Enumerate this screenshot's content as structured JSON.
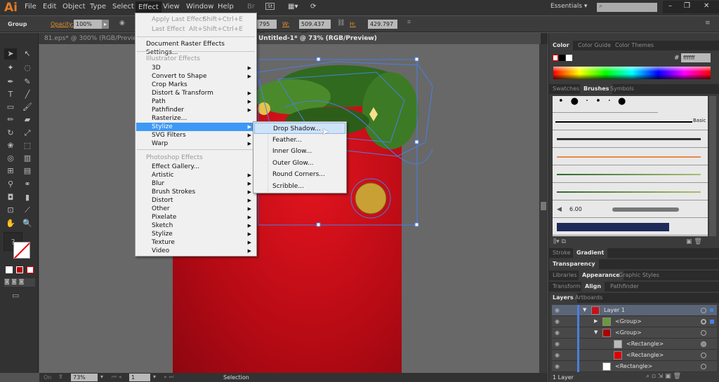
{
  "app": {
    "logo": "Ai"
  },
  "menubar": {
    "items": [
      "File",
      "Edit",
      "Object",
      "Type",
      "Select",
      "Effect",
      "View",
      "Window",
      "Help"
    ],
    "workspace": "Essentials",
    "search_placeholder": ""
  },
  "control": {
    "selection": "Group",
    "opacity_label": "Opacity:",
    "opacity": "100%",
    "x_value": "795 pt",
    "w_label": "W:",
    "w_value": "509.437 pt",
    "h_label": "H:",
    "h_value": "429.797 pt"
  },
  "doc_tabs": [
    {
      "label": "81.eps* @ 300% (RGB/Preview)",
      "active": false
    },
    {
      "label": "Untitled-1* @ 73% (RGB/Preview)",
      "active": true
    }
  ],
  "effect_menu": {
    "apply_last": {
      "label": "Apply Last Effect",
      "shortcut": "Shift+Ctrl+E"
    },
    "last": {
      "label": "Last Effect",
      "shortcut": "Alt+Shift+Ctrl+E"
    },
    "doc_raster": "Document Raster Effects Settings...",
    "illustrator_header": "Illustrator Effects",
    "illustrator_items": [
      "3D",
      "Convert to Shape",
      "Crop Marks",
      "Distort & Transform",
      "Path",
      "Pathfinder",
      "Rasterize...",
      "Stylize",
      "SVG Filters",
      "Warp"
    ],
    "photoshop_header": "Photoshop Effects",
    "photoshop_items": [
      "Effect Gallery...",
      "Artistic",
      "Blur",
      "Brush Strokes",
      "Distort",
      "Other",
      "Pixelate",
      "Sketch",
      "Stylize",
      "Texture",
      "Video"
    ],
    "highlighted": "Stylize"
  },
  "stylize_submenu": {
    "items": [
      "Drop Shadow...",
      "Feather...",
      "Inner Glow...",
      "Outer Glow...",
      "Round Corners...",
      "Scribble..."
    ],
    "highlighted": "Drop Shadow..."
  },
  "status": {
    "zoom": "73%",
    "artboard": "1",
    "tool": "Selection"
  },
  "panels": {
    "color_tabs": [
      "Color",
      "Color Guide",
      "Color Themes"
    ],
    "hex_label": "#",
    "hex": "ffffff",
    "swatch_tabs": [
      "Swatches",
      "Brushes",
      "Symbols"
    ],
    "brush_basic": "Basic",
    "brush_size": "6.00",
    "stroke_tabs": [
      "Stroke",
      "Gradient"
    ],
    "transparency_tab": "Transparency",
    "appearance_tabs": [
      "Libraries",
      "Appearance",
      "Graphic Styles"
    ],
    "transform_tabs": [
      "Transform",
      "Align",
      "Pathfinder"
    ],
    "layers_tabs": [
      "Layers",
      "Artboards"
    ],
    "layers": [
      {
        "name": "Layer 1"
      },
      {
        "name": "<Group>"
      },
      {
        "name": "<Group>"
      },
      {
        "name": "<Rectangle>"
      },
      {
        "name": "<Rectangle>"
      },
      {
        "name": "<Rectangle>"
      }
    ],
    "layers_count": "1 Layer"
  },
  "colors": {
    "accent": "#3e98f5",
    "artboard": "#c8101a",
    "selection": "#4a7fe0"
  }
}
